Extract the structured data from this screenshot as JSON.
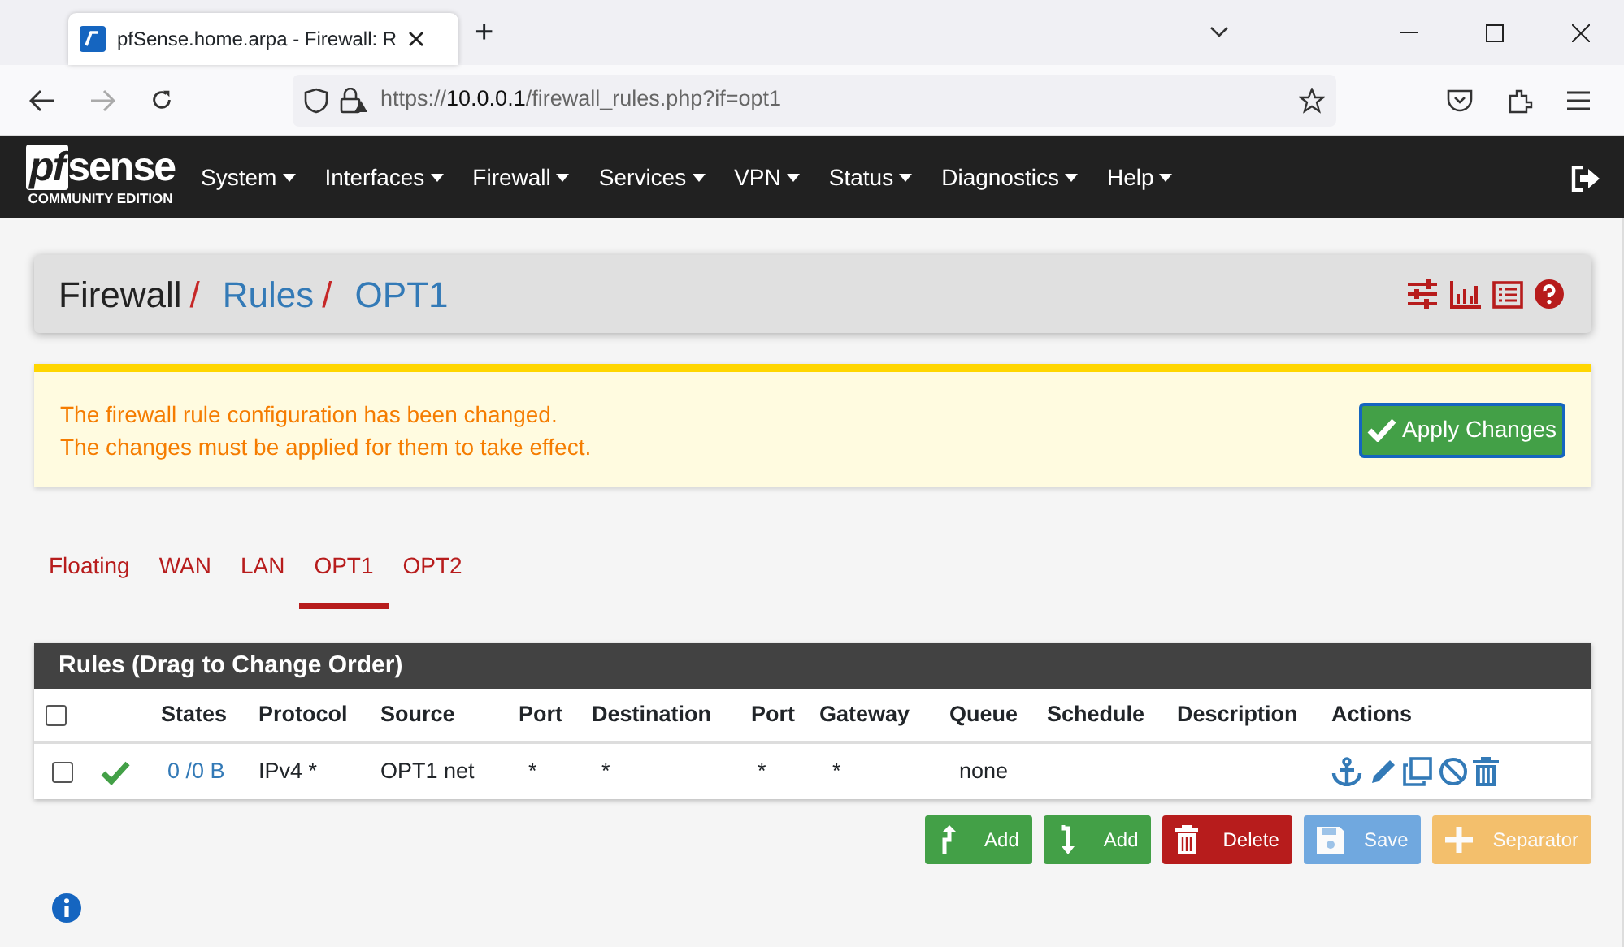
{
  "browser": {
    "tab_title": "pfSense.home.arpa - Firewall: R",
    "new_tab": "+",
    "url_scheme": "https://",
    "url_host": "10.0.0.1",
    "url_path": "/firewall_rules.php?if=opt1"
  },
  "navbar": {
    "logo_pf": "pf",
    "logo_sense": "sense",
    "logo_edition": "COMMUNITY EDITION",
    "menu": [
      "System",
      "Interfaces",
      "Firewall",
      "Services",
      "VPN",
      "Status",
      "Diagnostics",
      "Help"
    ]
  },
  "breadcrumb": [
    {
      "label": "Firewall",
      "link": false,
      "separator": "/"
    },
    {
      "label": "Rules",
      "link": true,
      "separator": "/"
    },
    {
      "label": "OPT1",
      "link": true
    }
  ],
  "alert": {
    "lines": [
      "The firewall rule configuration has been changed.",
      "The changes must be applied for them to take effect."
    ],
    "button": "Apply Changes"
  },
  "tabs": [
    {
      "label": "Floating",
      "selected": false
    },
    {
      "label": "WAN",
      "selected": false
    },
    {
      "label": "LAN",
      "selected": false
    },
    {
      "label": "OPT1",
      "selected": true
    },
    {
      "label": "OPT2",
      "selected": false
    }
  ],
  "table": {
    "title": "Rules (Drag to Change Order)",
    "header_checked": false,
    "columns": [
      "States",
      "Protocol",
      "Source",
      "Port",
      "Destination",
      "Port",
      "Gateway",
      "Queue",
      "Schedule",
      "Description",
      "Actions"
    ],
    "rows": [
      {
        "checked": false,
        "enabled": true,
        "cells": [
          "0 /0 B",
          "IPv4 *",
          "OPT1 net",
          "*",
          "*",
          "*",
          "*",
          "none",
          "",
          ""
        ]
      }
    ]
  },
  "buttons": [
    {
      "kind": "add_top",
      "label": "Add",
      "disabled": false
    },
    {
      "kind": "add_bottom",
      "label": "Add",
      "disabled": false
    },
    {
      "kind": "delete",
      "label": "Delete",
      "disabled": false
    },
    {
      "kind": "save",
      "label": "Save",
      "disabled": true
    },
    {
      "kind": "separator",
      "label": "Separator",
      "disabled": true
    }
  ]
}
